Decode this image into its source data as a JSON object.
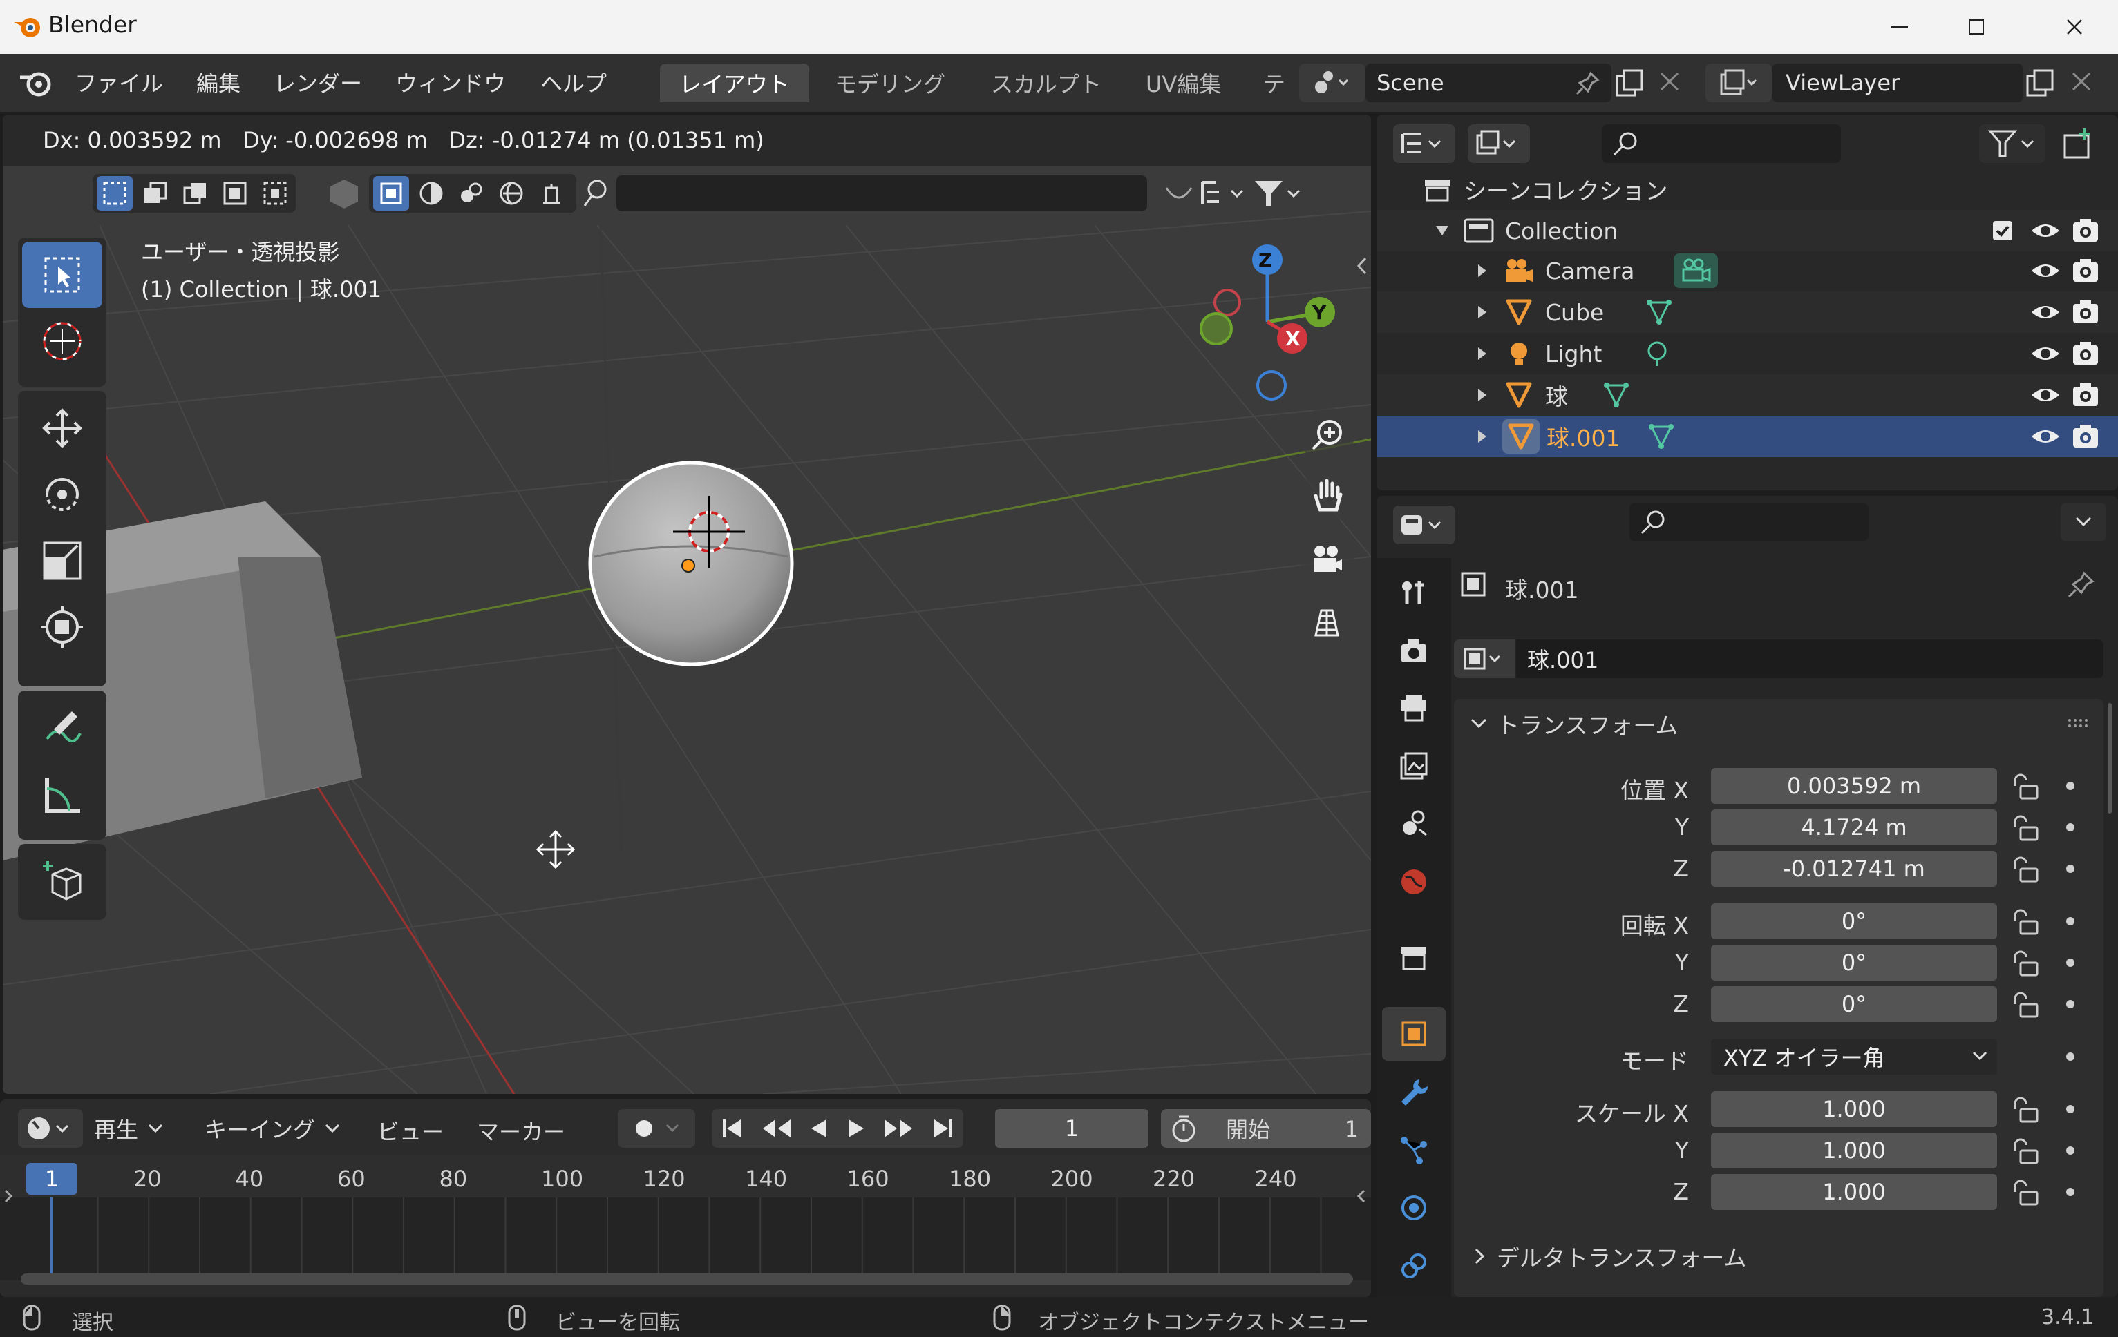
{
  "window": {
    "title": "Blender"
  },
  "menus": [
    "ファイル",
    "編集",
    "レンダー",
    "ウィンドウ",
    "ヘルプ"
  ],
  "workspaces": [
    "レイアウト",
    "モデリング",
    "スカルプト",
    "UV編集",
    "テ"
  ],
  "scene": {
    "name": "Scene"
  },
  "view_layer": {
    "name": "ViewLayer"
  },
  "viewport": {
    "header_readout": "Dx: 0.003592 m   Dy: -0.002698 m   Dz: -0.01274 m (0.01351 m)",
    "view_name": "ユーザー・透視投影",
    "context": "(1) Collection | 球.001",
    "gizmo": {
      "z": "Z",
      "y": "Y",
      "x": "X"
    }
  },
  "outliner": {
    "root": "シーンコレクション",
    "collection": "Collection",
    "items": [
      {
        "name": "Camera",
        "selected": false
      },
      {
        "name": "Cube",
        "selected": false
      },
      {
        "name": "Light",
        "selected": false
      },
      {
        "name": "球",
        "selected": false
      },
      {
        "name": "球.001",
        "selected": true
      }
    ]
  },
  "properties": {
    "object_name": "球.001",
    "datablock_name": "球.001",
    "transform_title": "トランスフォーム",
    "location_label": "位置 X",
    "rotation_label": "回転 X",
    "scale_label": "スケール X",
    "y_label": "Y",
    "z_label": "Z",
    "location": [
      "0.003592 m",
      "4.1724 m",
      "-0.012741 m"
    ],
    "rotation": [
      "0°",
      "0°",
      "0°"
    ],
    "mode_label": "モード",
    "mode_value": "XYZ オイラー角",
    "scale": [
      "1.000",
      "1.000",
      "1.000"
    ],
    "delta_title": "デルタトランスフォーム"
  },
  "timeline": {
    "menus": [
      "再生",
      "キーイング",
      "ビュー",
      "マーカー"
    ],
    "current_frame": "1",
    "start_label": "開始",
    "start_value": "1",
    "frame_marker": "1",
    "ruler": [
      "20",
      "40",
      "60",
      "80",
      "100",
      "120",
      "140",
      "160",
      "180",
      "200",
      "220",
      "240"
    ]
  },
  "statusbar": {
    "select": "選択",
    "rotate_view": "ビューを回転",
    "context_menu": "オブジェクトコンテクストメニュー",
    "version": "3.4.1"
  }
}
